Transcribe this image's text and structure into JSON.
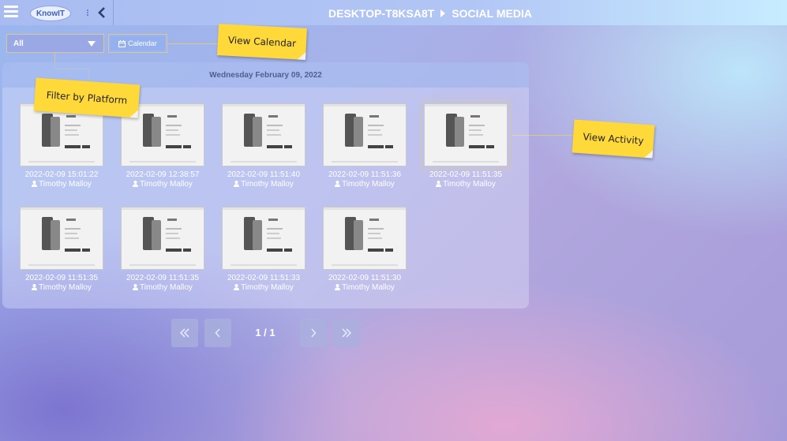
{
  "header": {
    "logo_text": "KnowIT",
    "breadcrumb": [
      "DESKTOP-T8KSA8T",
      "SOCIAL MEDIA"
    ]
  },
  "toolbar": {
    "filter_value": "All",
    "calendar_label": "Calendar"
  },
  "annotations": {
    "view_calendar": "View Calendar",
    "filter_by_platform": "Filter by Platform",
    "view_activity": "View Activity"
  },
  "panel": {
    "date_heading": "Wednesday February 09, 2022",
    "cards": [
      {
        "timestamp": "2022-02-09 15:01:22",
        "user": "Timothy Malloy"
      },
      {
        "timestamp": "2022-02-09 12:38:57",
        "user": "Timothy Malloy"
      },
      {
        "timestamp": "2022-02-09 11:51:40",
        "user": "Timothy Malloy"
      },
      {
        "timestamp": "2022-02-09 11:51:36",
        "user": "Timothy Malloy"
      },
      {
        "timestamp": "2022-02-09 11:51:35",
        "user": "Timothy Malloy"
      },
      {
        "timestamp": "2022-02-09 11:51:35",
        "user": "Timothy Malloy"
      },
      {
        "timestamp": "2022-02-09 11:51:35",
        "user": "Timothy Malloy"
      },
      {
        "timestamp": "2022-02-09 11:51:33",
        "user": "Timothy Malloy"
      },
      {
        "timestamp": "2022-02-09 11:51:30",
        "user": "Timothy Malloy"
      }
    ]
  },
  "pagination": {
    "label": "1 / 1"
  },
  "colors": {
    "accent_note": "#ffd83a",
    "connector": "#d7c985"
  }
}
